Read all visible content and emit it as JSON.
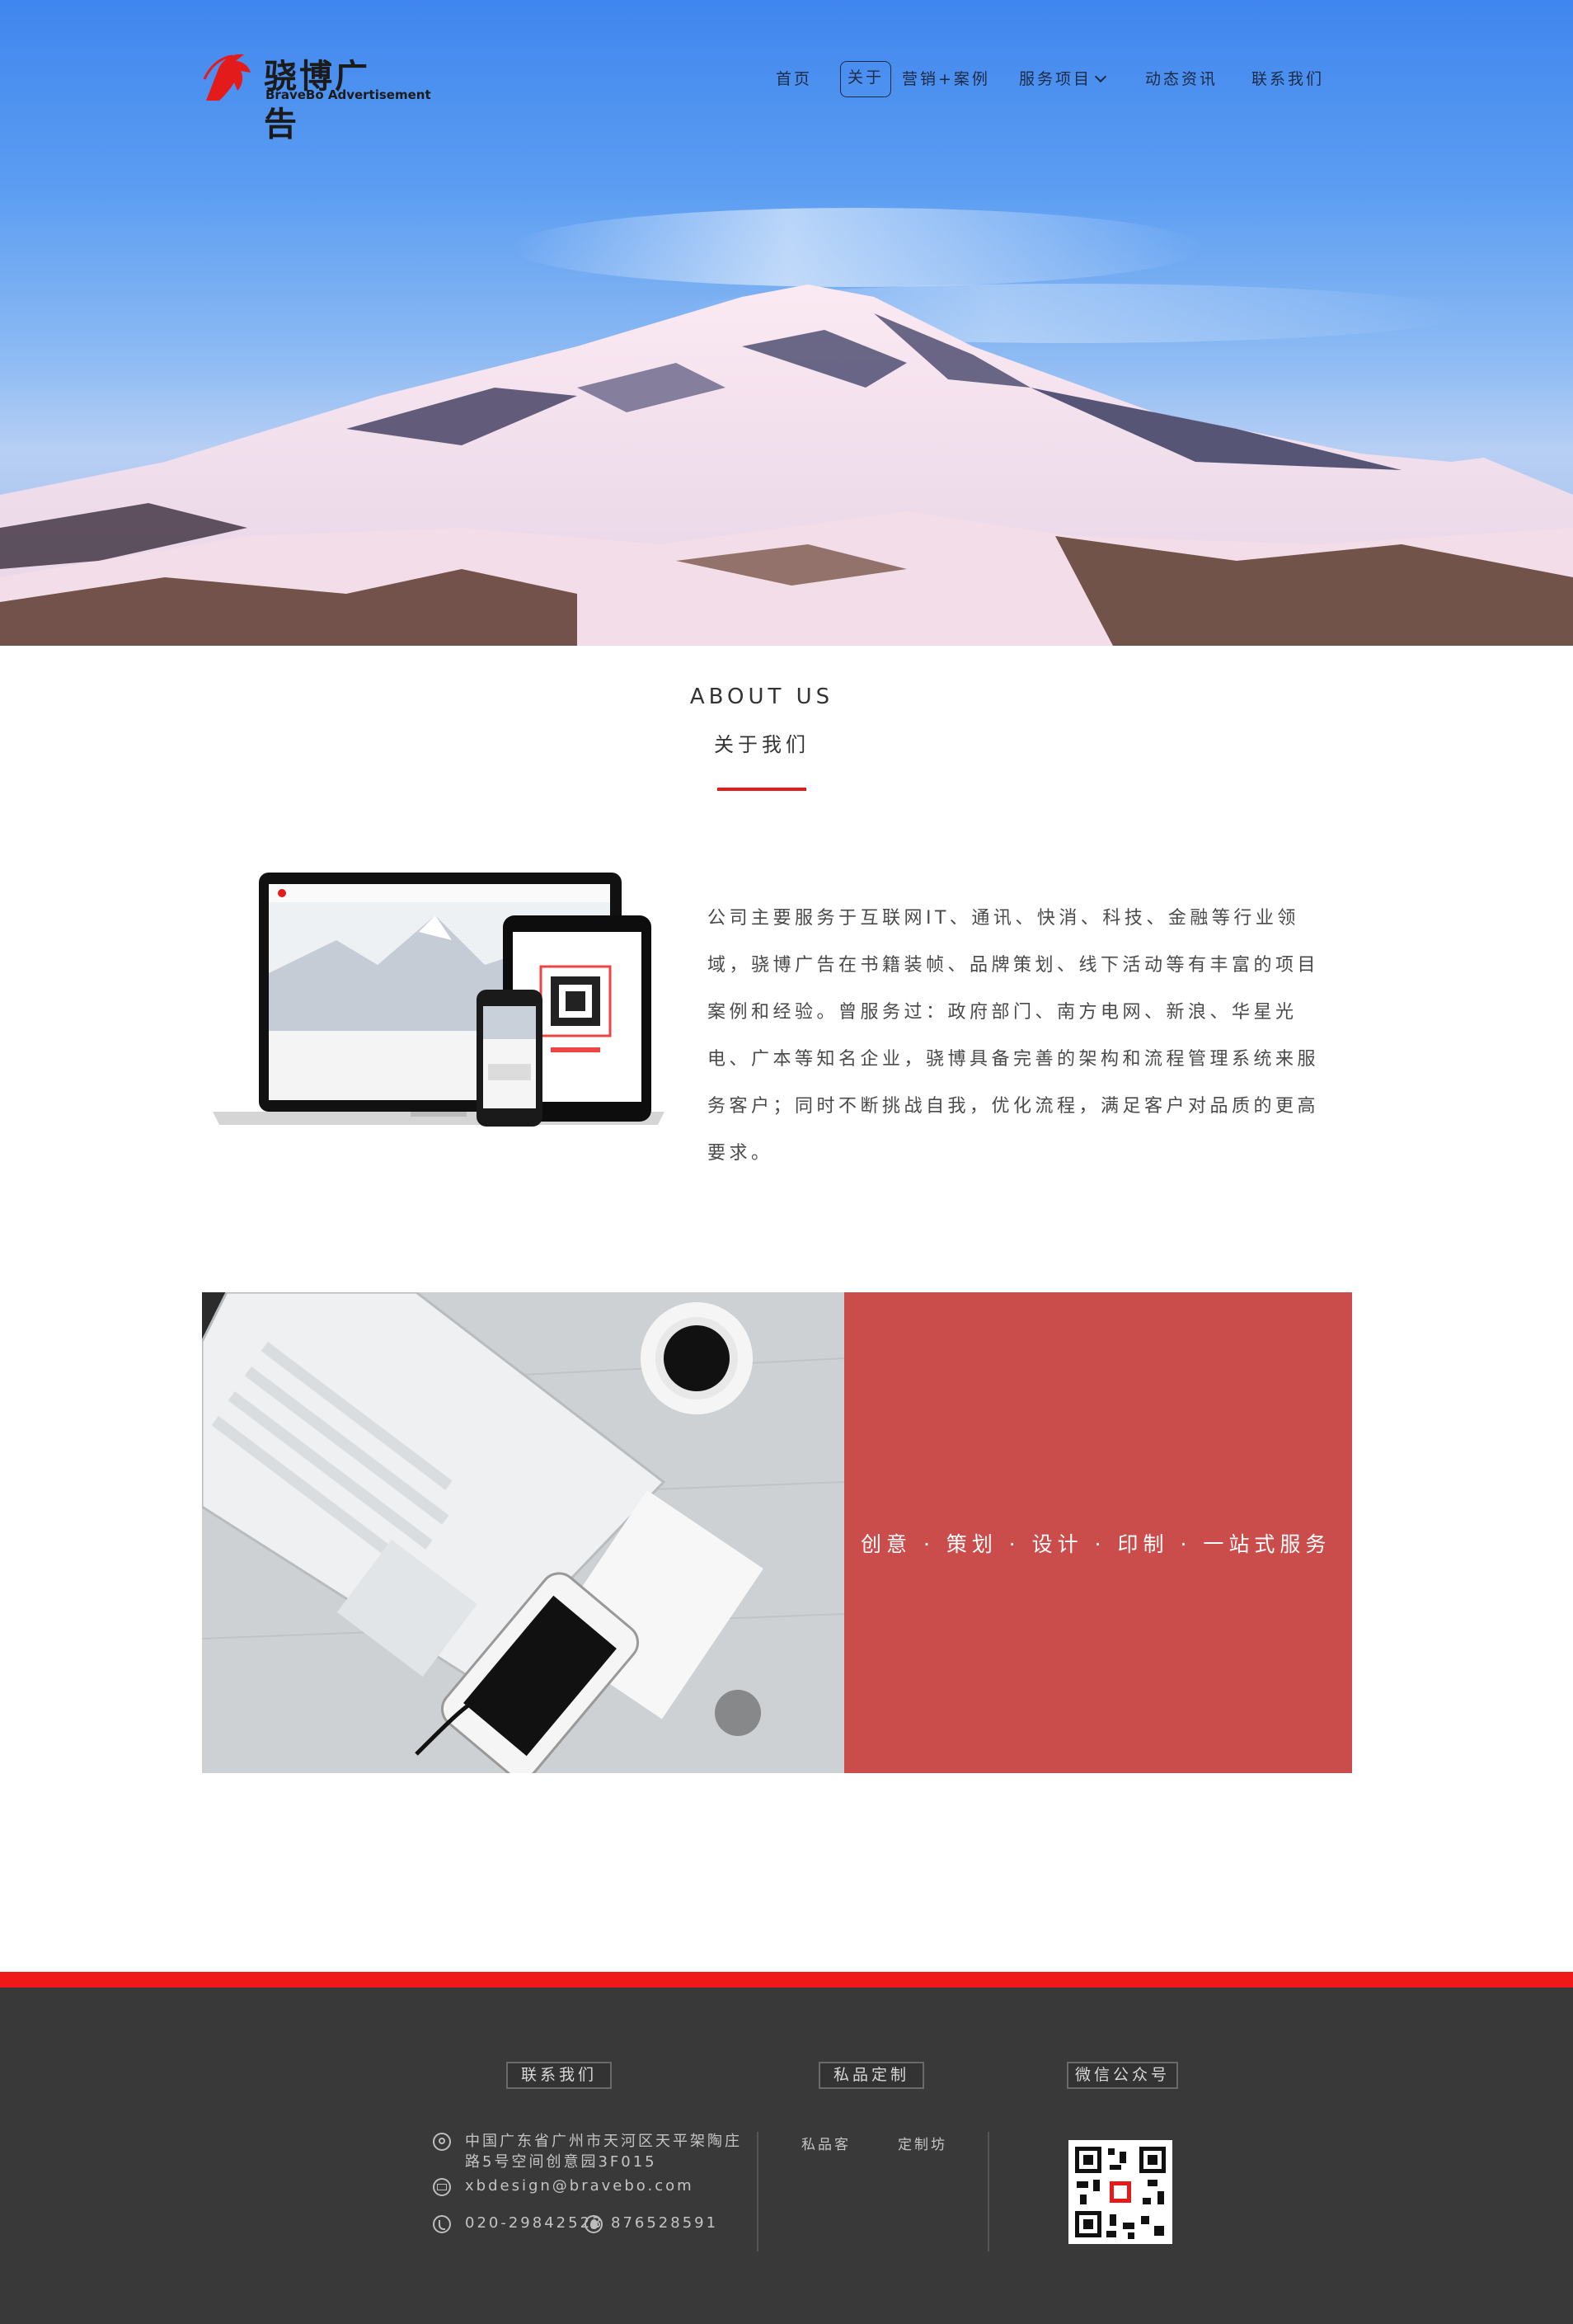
{
  "brand": {
    "name_cn": "骁博广告",
    "name_en": "BraveBo Advertisement",
    "accent_color": "#e41b1b"
  },
  "nav": {
    "items": [
      {
        "label": "首页"
      },
      {
        "label": "关于",
        "active": true
      },
      {
        "label": "营销+案例"
      },
      {
        "label": "服务项目",
        "has_dropdown": true
      },
      {
        "label": "动态资讯"
      },
      {
        "label": "联系我们"
      }
    ]
  },
  "about": {
    "title_en": "ABOUT US",
    "title_cn": "关于我们",
    "body": "公司主要服务于互联网IT、通讯、快消、科技、金融等行业领域，骁博广告在书籍装帧、品牌策划、线下活动等有丰富的项目案例和经验。曾服务过：政府部门、南方电网、新浪、华星光电、广本等知名企业，骁博具备完善的架构和流程管理系统来服务客户；同时不断挑战自我，优化流程，满足客户对品质的更高要求。"
  },
  "service_banner": {
    "text": "创意 · 策划 · 设计 · 印制 · 一站式服务",
    "color": "#cb4d4b"
  },
  "footer": {
    "contact": {
      "heading": "联系我们",
      "address": [
        "中国广东省广州市天河区天平架陶庄",
        "路5号空间创意园3F015"
      ],
      "email": "xbdesign@bravebo.com",
      "phone": "020-29842523",
      "qq": "876528591"
    },
    "custom": {
      "heading": "私品定制",
      "links": [
        "私品客",
        "定制坊"
      ]
    },
    "wechat": {
      "heading": "微信公众号"
    },
    "bg_color": "#393939",
    "stripe_color": "#f01818"
  }
}
